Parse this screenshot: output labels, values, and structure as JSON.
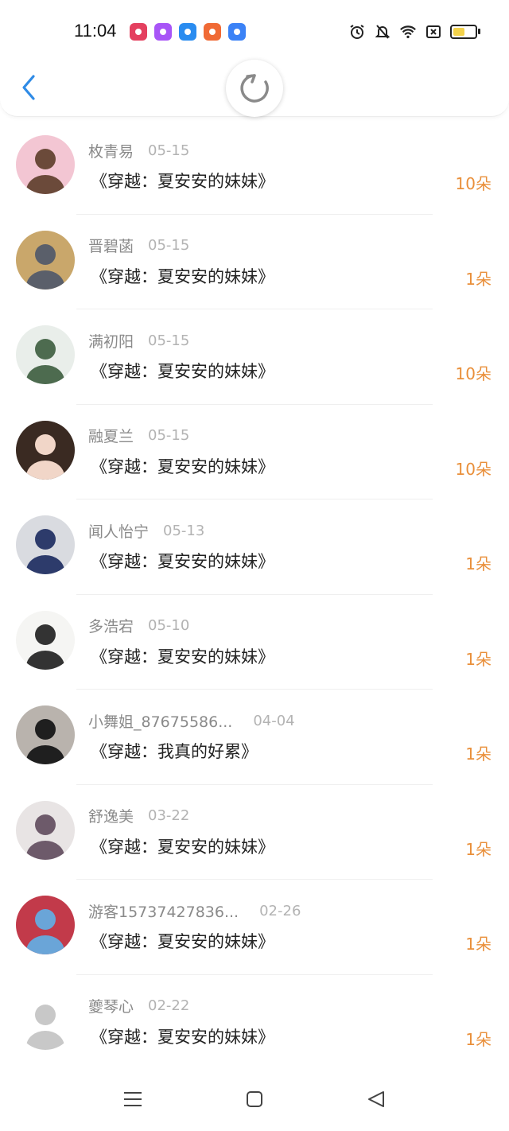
{
  "status_bar": {
    "time": "11:04",
    "app_icons": [
      {
        "name": "weibo-app-icon",
        "color": "#e4405f"
      },
      {
        "name": "shortcut-app-icon",
        "color": "#a855f7"
      },
      {
        "name": "feather-app-icon",
        "color": "#2a8cf0"
      },
      {
        "name": "book-app-icon",
        "color": "#f06a35"
      },
      {
        "name": "chat-app-icon",
        "color": "#3b82f6"
      }
    ],
    "battery_level": 0.65
  },
  "header": {
    "back_icon": "chevron-left-icon",
    "refresh_icon": "refresh-icon"
  },
  "list": [
    {
      "name": "枚青易",
      "date": "05-15",
      "book": "《穿越：夏安安的妹妹》",
      "flowers": "10朵",
      "avatar_colors": [
        "#f3c6d3",
        "#6b4a3a"
      ]
    },
    {
      "name": "晋碧菡",
      "date": "05-15",
      "book": "《穿越：夏安安的妹妹》",
      "flowers": "1朵",
      "avatar_colors": [
        "#c9a76b",
        "#5a5f6a"
      ]
    },
    {
      "name": "满初阳",
      "date": "05-15",
      "book": "《穿越：夏安安的妹妹》",
      "flowers": "10朵",
      "avatar_colors": [
        "#e9eeea",
        "#4d6b4f"
      ]
    },
    {
      "name": "融夏兰",
      "date": "05-15",
      "book": "《穿越：夏安安的妹妹》",
      "flowers": "10朵",
      "avatar_colors": [
        "#3a2a22",
        "#f1d6c8"
      ]
    },
    {
      "name": "闻人怡宁",
      "date": "05-13",
      "book": "《穿越：夏安安的妹妹》",
      "flowers": "1朵",
      "avatar_colors": [
        "#d9dbe0",
        "#2d3b6b"
      ]
    },
    {
      "name": "多浩宕",
      "date": "05-10",
      "book": "《穿越：夏安安的妹妹》",
      "flowers": "1朵",
      "avatar_colors": [
        "#f5f5f3",
        "#333333"
      ]
    },
    {
      "name": "小舞姐_87675586...",
      "date": "04-04",
      "book": "《穿越：我真的好累》",
      "flowers": "1朵",
      "avatar_colors": [
        "#b9b3ad",
        "#1f1f1f"
      ]
    },
    {
      "name": "舒逸美",
      "date": "03-22",
      "book": "《穿越：夏安安的妹妹》",
      "flowers": "1朵",
      "avatar_colors": [
        "#e8e4e4",
        "#6d5a6a"
      ]
    },
    {
      "name": "游客15737427836...",
      "date": "02-26",
      "book": "《穿越：夏安安的妹妹》",
      "flowers": "1朵",
      "avatar_colors": [
        "#c23a4a",
        "#6aa5d8"
      ]
    },
    {
      "name": "夔琴心",
      "date": "02-22",
      "book": "《穿越：夏安安的妹妹》",
      "flowers": "1朵",
      "avatar_colors": [
        "#ffffff",
        "#c8c8c8"
      ]
    }
  ],
  "nav_bar": {
    "menu_icon": "menu-icon",
    "home_icon": "home-icon",
    "back_icon": "back-triangle-icon"
  }
}
